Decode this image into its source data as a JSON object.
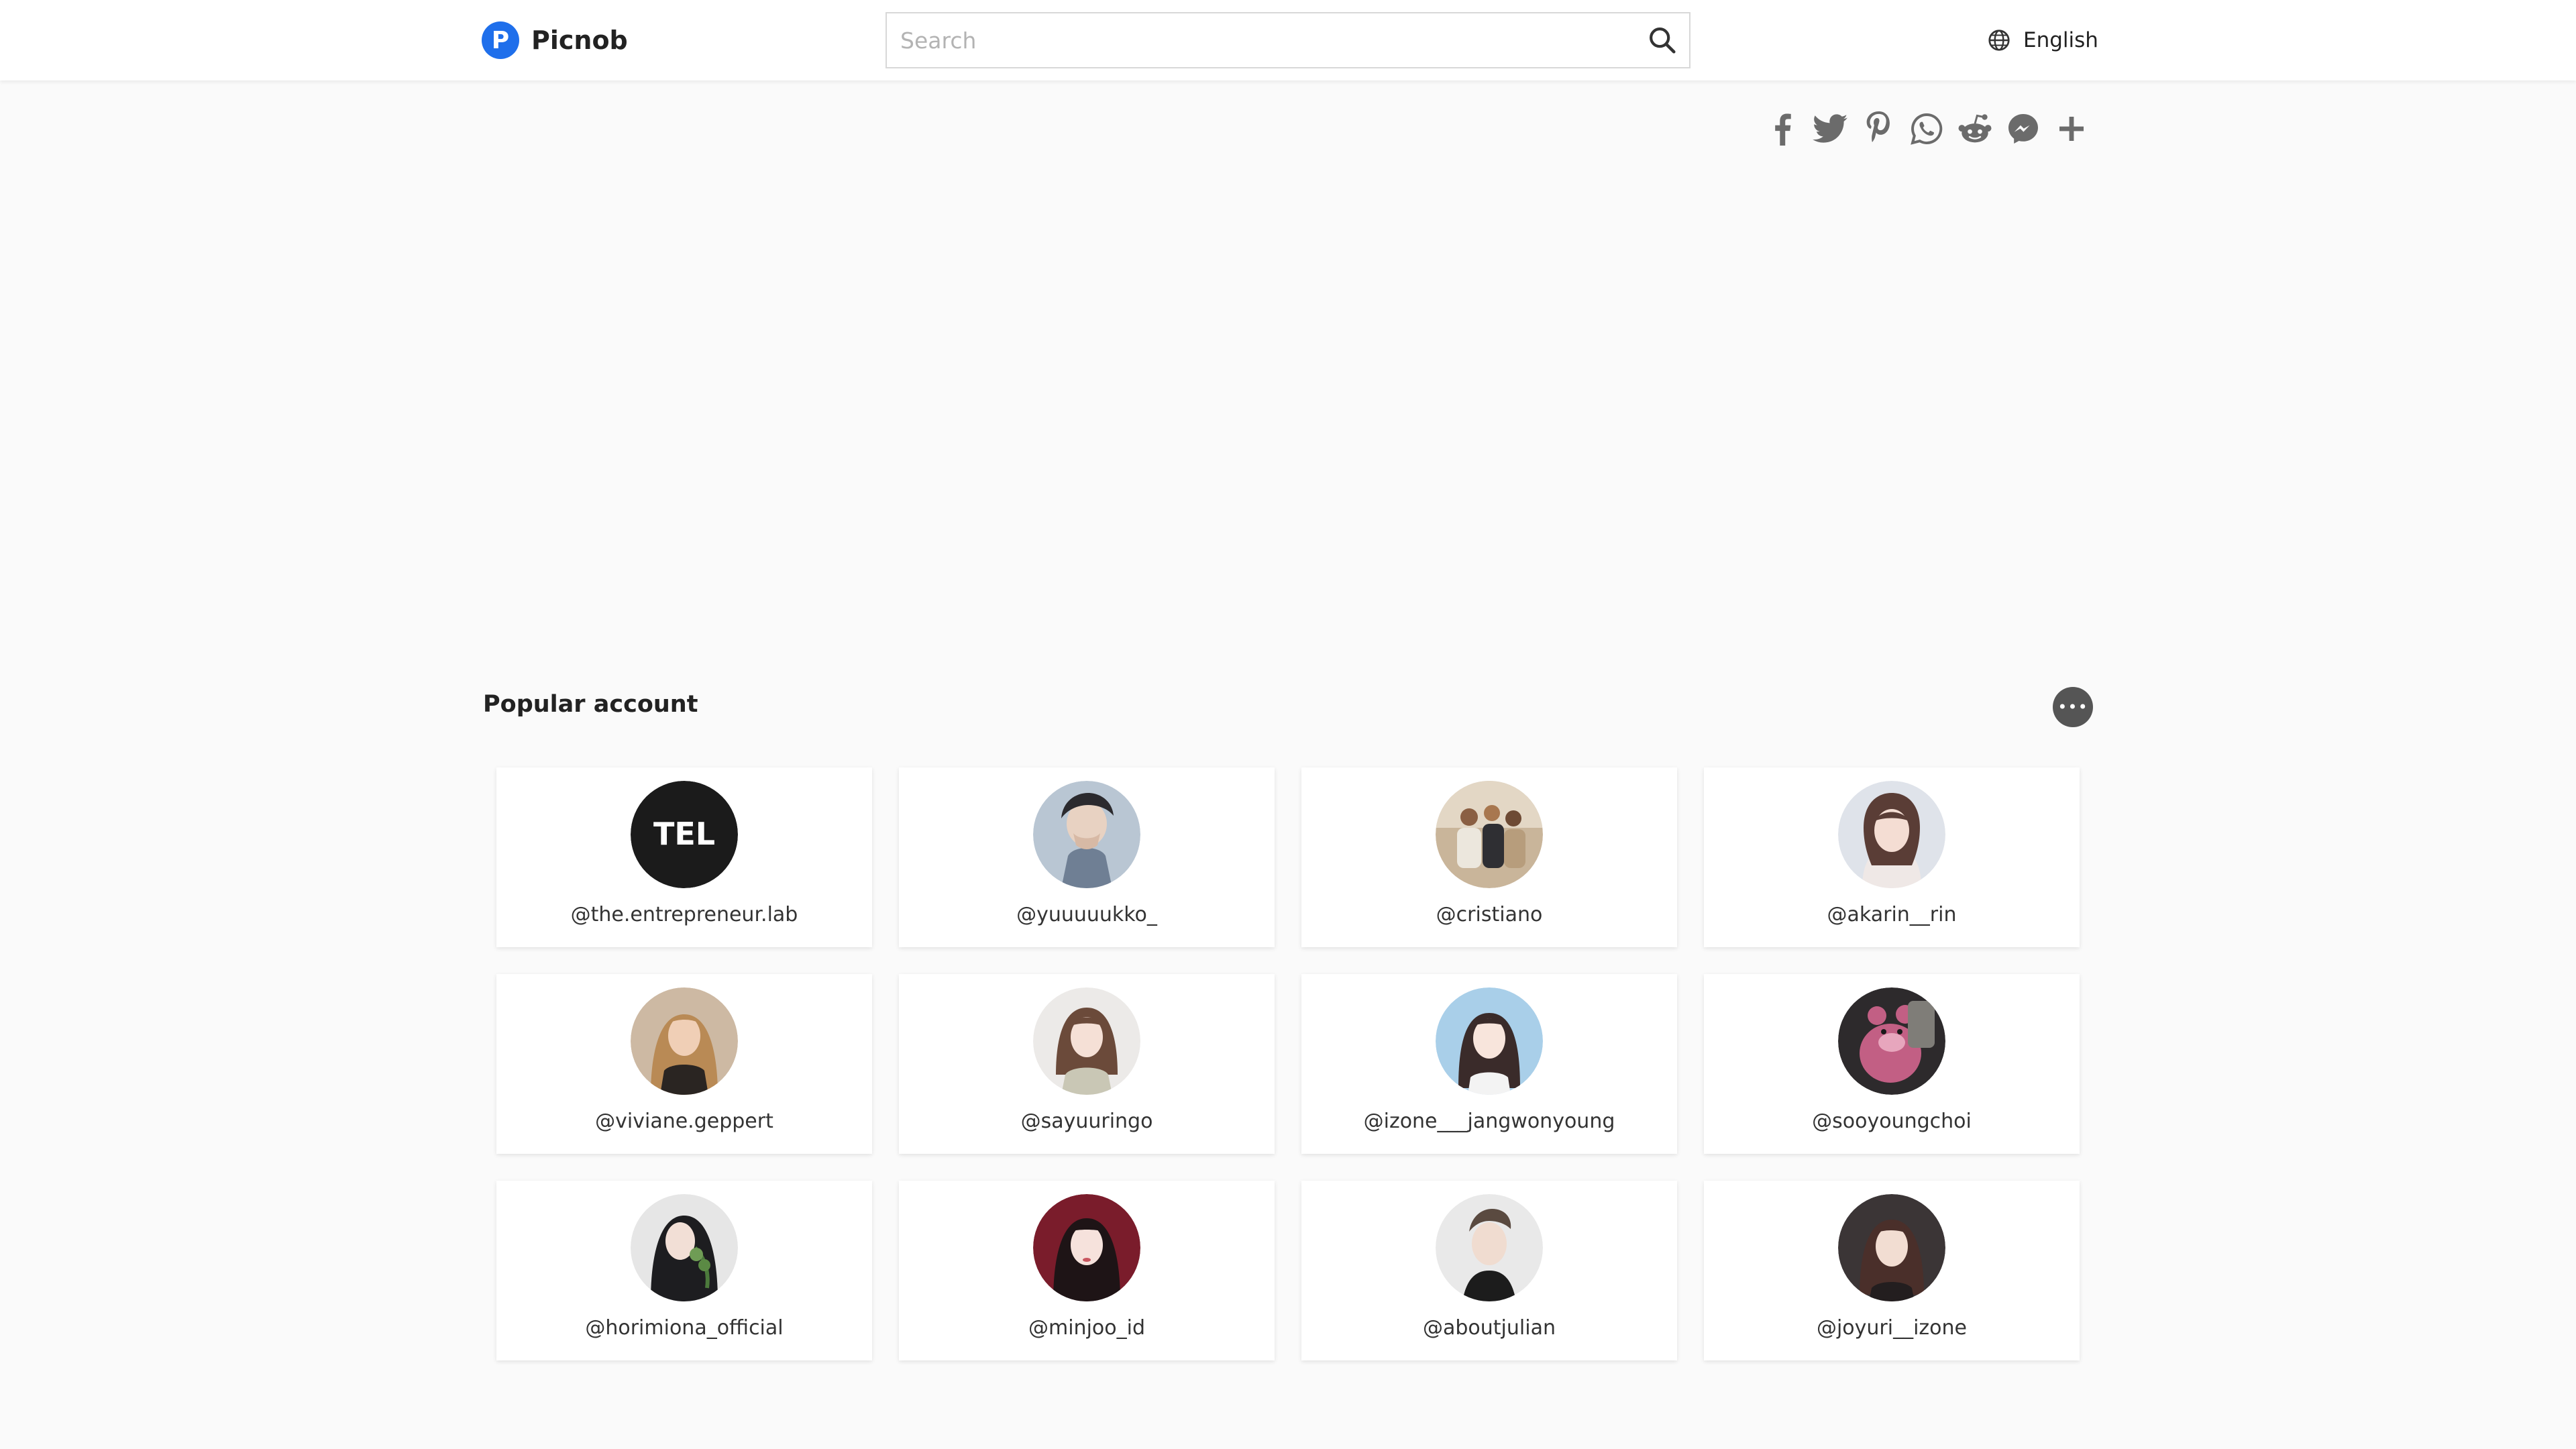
{
  "brand": {
    "logo_letter": "P",
    "name": "Picnob"
  },
  "search": {
    "placeholder": "Search",
    "value": ""
  },
  "language": {
    "label": "English"
  },
  "share_icons": [
    "facebook-icon",
    "twitter-icon",
    "pinterest-icon",
    "whatsapp-icon",
    "reddit-icon",
    "messenger-icon",
    "plus-icon"
  ],
  "popular": {
    "title": "Popular account",
    "more_label": "•••",
    "accounts": [
      {
        "handle": "@the.entrepreneur.lab",
        "avatar_text": "TEL"
      },
      {
        "handle": "@yuuuuukko_"
      },
      {
        "handle": "@cristiano"
      },
      {
        "handle": "@akarin__rin"
      },
      {
        "handle": "@viviane.geppert"
      },
      {
        "handle": "@sayuuringo"
      },
      {
        "handle": "@izone___jangwonyoung"
      },
      {
        "handle": "@sooyoungchoi"
      },
      {
        "handle": "@horimiona_official"
      },
      {
        "handle": "@minjoo_id"
      },
      {
        "handle": "@aboutjulian"
      },
      {
        "handle": "@joyuri__izone"
      }
    ]
  },
  "colors": {
    "brand_blue": "#1f6feb",
    "page_bg": "#fafafa",
    "icon_gray": "#6b6b6b"
  }
}
